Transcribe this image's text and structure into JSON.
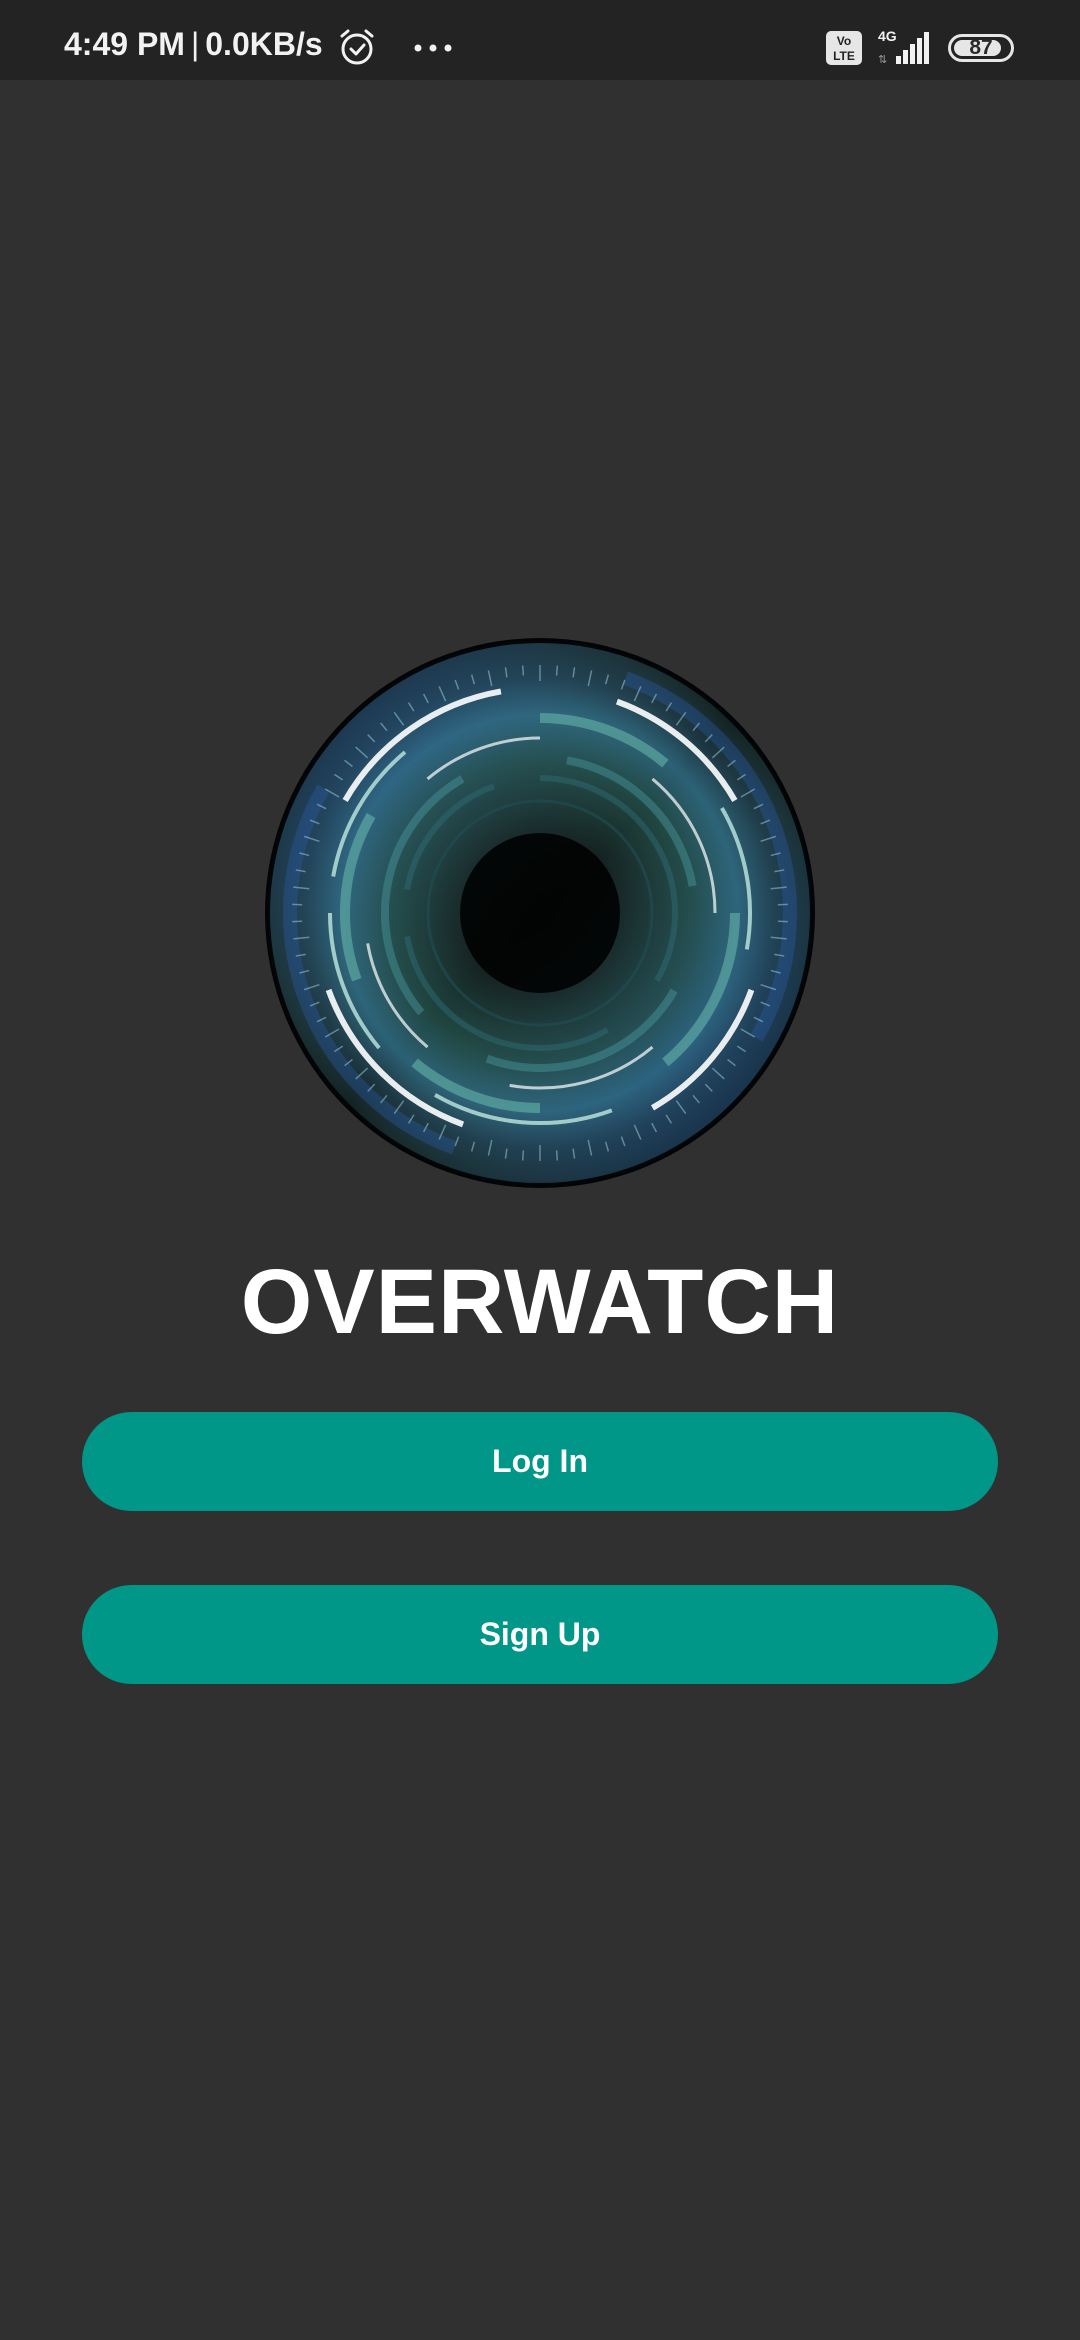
{
  "status_bar": {
    "time": "4:49 PM",
    "separator": "|",
    "network_speed": "0.0KB/s",
    "alarm_icon": "alarm-clock-icon",
    "more_icon": "more-dots-icon",
    "volte_label_top": "Vo",
    "volte_label_bottom": "LTE",
    "network_type": "4G",
    "signal_bars": 5,
    "battery_level": 87,
    "battery_text": "87"
  },
  "logo": {
    "icon": "circular-tech-ring-logo",
    "colors": [
      "#000000",
      "#1e5aa8",
      "#6fc4b0",
      "#ffffff"
    ]
  },
  "app": {
    "title": "OVERWATCH"
  },
  "actions": {
    "login_label": "Log In",
    "signup_label": "Sign Up"
  },
  "theme": {
    "background": "#303030",
    "status_bar_bg": "#232323",
    "button_color": "#009688",
    "text_color": "#ffffff"
  }
}
